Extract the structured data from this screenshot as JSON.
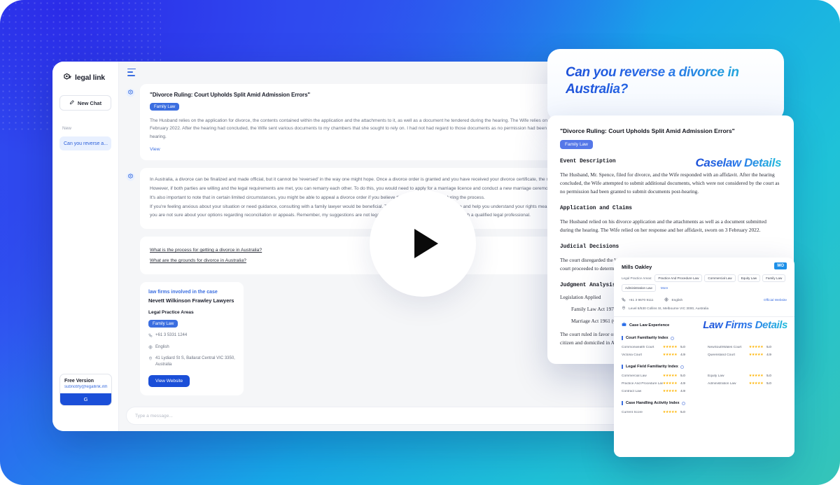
{
  "brand": {
    "name": "legal link",
    "logo_icon": "legal-link-logo-icon"
  },
  "sidebar": {
    "new_chat_label": "New Chat",
    "new_chat_icon": "compose-icon",
    "section_label": "New",
    "chat_items": [
      {
        "label": "Can you reverse a..."
      }
    ],
    "free_version": {
      "title": "Free Version",
      "email": "subnotify@legallink.inh",
      "button_label": "G"
    }
  },
  "chat": {
    "menu_icon": "hamburger-menu-icon",
    "bot_icon": "legal-link-bot-icon",
    "case_card": {
      "title": "\"Divorce Ruling: Court Upholds Split Amid Admission Errors\"",
      "tag": "Family Law",
      "body": "The Husband relies on the application for divorce, the contents contained within the application and the attachments to it, as well as a document he tendered during the hearing. The Wife relies on her response and her affidavit sworn by her on 3 February 2022. After the hearing had concluded, the Wife sent various documents to my chambers that she sought to rely on. I had not had regard to those documents as no permission had been granted to the Wife to submit documents after the hearing.",
      "view_label": "View"
    },
    "answer_lines": [
      "In Australia, a divorce can be finalized and made official, but it cannot be 'reversed' in the way one might hope. Once a divorce order is granted and you have received your divorce certificate, the m",
      "However, if both parties are willing and the legal requirements are met, you can remarry each other. To do this, you would need to apply for a marriage licence and conduct a new marriage ceremony.",
      "It's also important to note that in certain limited circumstances, you might be able to appeal a divorce order if you believe there were errors made during the process.",
      "If you're feeling anxious about your situation or need guidance, consulting with a family lawyer would be beneficial. They can provide personalised advice and help you understand your rights meaningfully if",
      "you are not sure about your options regarding reconciliation or appeals. Remember, my suggestions are not legal advice, and it is always best to consult with a qualified legal professional."
    ],
    "followups": [
      "What is the process for getting a divorce in Australia?",
      "What are the grounds for divorce in Australia?"
    ],
    "firm_card": {
      "kicker": "law firms involved in the case",
      "name": "Nevett Wilkinson Frawley Lawyers",
      "practice_heading": "Legal Practice Areas",
      "tag": "Family Law",
      "phone": "+61 3 5331 1244",
      "phone_icon": "phone-icon",
      "language": "English",
      "language_icon": "globe-icon",
      "address": "41 Lydiard St S, Ballarat Central VIC 3350, Australia",
      "address_icon": "location-pin-icon",
      "button_label": "View Website"
    },
    "composer_placeholder": "Type a message..."
  },
  "play_button": {
    "label": "play-video",
    "icon": "play-triangle-icon"
  },
  "speech_bubble": {
    "text": "Can you reverse a divorce in Australia?"
  },
  "caselaw": {
    "watermark": "Caselaw Details",
    "title": "\"Divorce Ruling: Court Upholds Split Amid Admission Errors\"",
    "tag": "Family Law",
    "sections": [
      {
        "heading": "Event Description",
        "body": "The Husband, Mr. Spence, filed for divorce, and the Wife responded with an affidavit. After the hearing concluded, the Wife attempted to submit additional documents, which were not considered by the court as no permission had been granted to submit documents post-hearing."
      },
      {
        "heading": "Application and Claims",
        "body": "The Husband relied on his divorce application and the attachments as well as a document submitted during the hearing. The Wife relied on her response and her affidavit, sworn on 3 February 2022."
      },
      {
        "heading": "Judicial Decisions",
        "body": "The court disregarded the Wife's post-hearing documents as they were submitted without permission. The court proceeded to determine the application on the material before it."
      }
    ],
    "judgment_heading": "Judgment Analysis",
    "legislation_heading": "Legislation Applied",
    "legislation": [
      "Family Law Act 1975 (Cth)",
      "Marriage Act 1961 (Cth)"
    ],
    "judgment_body": "The court ruled in favor of the Husband, granting the divorce. The Wife was found to be an Australian citizen and domiciled in Australia."
  },
  "firm_panel": {
    "watermark": "Law Firms Details",
    "logo_label": "MO",
    "name": "Mills Oakley",
    "areas_label": "Legal Practice Areas:",
    "areas": [
      "Practice And Procedure Law",
      "Commercial Law",
      "Equity Law",
      "Family Law",
      "Administration Law"
    ],
    "more_label": "More",
    "phone": "+61 3 9670 9111",
    "phone_icon": "phone-icon",
    "language": "English",
    "language_icon": "globe-icon",
    "official_website": "Official Website",
    "address": "Level 6/530 Collins St, Melbourne VIC 3000, Australia",
    "address_icon": "location-pin-icon",
    "experience_label": "Case Law Experience",
    "experience_icon": "briefcase-icon",
    "court_index": {
      "heading": "Court Familiarity Index",
      "rows": [
        {
          "name": "Commonwealth Court",
          "score": "5.0",
          "stars": 5
        },
        {
          "name": "NewSouthWales Court",
          "score": "5.0",
          "stars": 5
        },
        {
          "name": "Victoria Court",
          "score": "4.9",
          "stars": 5
        },
        {
          "name": "Queensland Court",
          "score": "4.9",
          "stars": 5
        }
      ]
    },
    "field_index": {
      "heading": "Legal Field Familiarity Index",
      "rows": [
        {
          "name": "Commercial Law",
          "score": "5.0",
          "stars": 5
        },
        {
          "name": "Equity Law",
          "score": "5.0",
          "stars": 5
        },
        {
          "name": "Practice And Procedure Law",
          "score": "4.9",
          "stars": 5
        },
        {
          "name": "Administration Law",
          "score": "5.0",
          "stars": 5
        },
        {
          "name": "Contract Law",
          "score": "4.9",
          "stars": 5
        }
      ]
    },
    "activity_index": {
      "heading": "Case Handling Activity Index",
      "rows": [
        {
          "name": "Current Score",
          "score": "5.0",
          "stars": 5
        }
      ]
    }
  },
  "colors": {
    "brand_blue": "#1b4fd8",
    "accent_blue": "#3b6ee0",
    "teal": "#35c4b8",
    "star_gold": "#ffb400"
  }
}
